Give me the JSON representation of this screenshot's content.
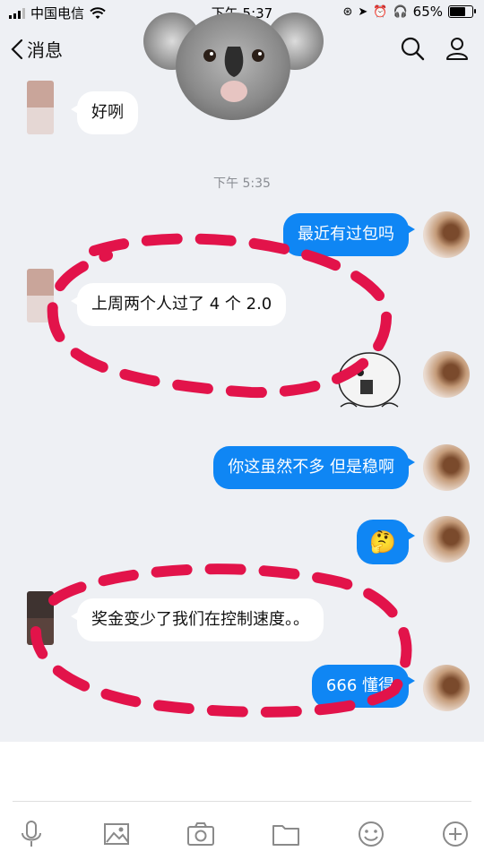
{
  "status_bar": {
    "carrier": "中国电信",
    "time": "下午 5:37",
    "battery_percent": "65%",
    "battery_level": 0.65
  },
  "nav": {
    "back_label": "消息",
    "search_icon": "search-icon",
    "profile_icon": "person-icon"
  },
  "chat": {
    "timestamp": "下午 5:35",
    "messages": [
      {
        "side": "in",
        "text": "好咧"
      },
      {
        "side": "out",
        "text": "最近有过包吗"
      },
      {
        "side": "in",
        "text": "上周两个人过了 4 个 2.0"
      },
      {
        "side": "out",
        "type": "sticker",
        "icon": "cartoon-face-sticker"
      },
      {
        "side": "out",
        "text": "你这虽然不多 但是稳啊"
      },
      {
        "side": "out",
        "type": "emoji",
        "text": "🤔"
      },
      {
        "side": "in",
        "text": "奖金变少了我们在控制速度。。"
      },
      {
        "side": "out",
        "text": "666  懂得"
      }
    ]
  },
  "toolbar": {
    "tools": [
      "microphone-icon",
      "image-icon",
      "camera-icon",
      "folder-icon",
      "emoji-icon",
      "add-icon"
    ]
  },
  "colors": {
    "bubble_out": "#0f86f4",
    "bubble_in": "#ffffff",
    "background": "#eef0f4",
    "dash_annotation": "#e2134a"
  }
}
